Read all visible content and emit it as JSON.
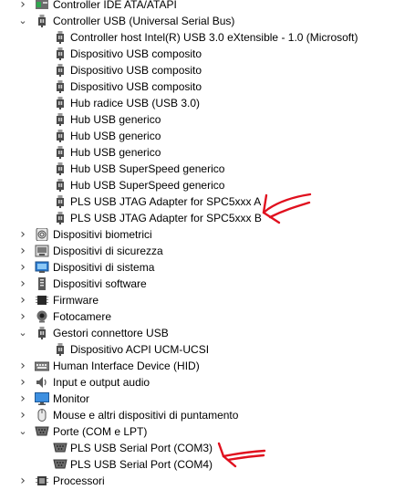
{
  "tree": [
    {
      "label": "Controller IDE ATA/ATAPI",
      "level": 0,
      "expand": "collapsed",
      "icon": "ide-controller-icon"
    },
    {
      "label": "Controller USB (Universal Serial Bus)",
      "level": 0,
      "expand": "expanded",
      "icon": "usb-plug-icon"
    },
    {
      "label": "Controller host Intel(R) USB 3.0 eXtensible - 1.0 (Microsoft)",
      "level": 1,
      "icon": "usb-plug-icon"
    },
    {
      "label": "Dispositivo USB composito",
      "level": 1,
      "icon": "usb-plug-icon"
    },
    {
      "label": "Dispositivo USB composito",
      "level": 1,
      "icon": "usb-plug-icon"
    },
    {
      "label": "Dispositivo USB composito",
      "level": 1,
      "icon": "usb-plug-icon"
    },
    {
      "label": "Hub radice USB (USB 3.0)",
      "level": 1,
      "icon": "usb-plug-icon"
    },
    {
      "label": "Hub USB generico",
      "level": 1,
      "icon": "usb-plug-icon"
    },
    {
      "label": "Hub USB generico",
      "level": 1,
      "icon": "usb-plug-icon"
    },
    {
      "label": "Hub USB generico",
      "level": 1,
      "icon": "usb-plug-icon"
    },
    {
      "label": "Hub USB SuperSpeed generico",
      "level": 1,
      "icon": "usb-plug-icon"
    },
    {
      "label": "Hub USB SuperSpeed generico",
      "level": 1,
      "icon": "usb-plug-icon"
    },
    {
      "label": "PLS USB JTAG Adapter for SPC5xxx A",
      "level": 1,
      "icon": "usb-plug-icon"
    },
    {
      "label": "PLS USB JTAG Adapter for SPC5xxx B",
      "level": 1,
      "icon": "usb-plug-icon"
    },
    {
      "label": "Dispositivi biometrici",
      "level": 0,
      "expand": "collapsed",
      "icon": "fingerprint-icon"
    },
    {
      "label": "Dispositivi di sicurezza",
      "level": 0,
      "expand": "collapsed",
      "icon": "security-device-icon"
    },
    {
      "label": "Dispositivi di sistema",
      "level": 0,
      "expand": "collapsed",
      "icon": "system-device-icon"
    },
    {
      "label": "Dispositivi software",
      "level": 0,
      "expand": "collapsed",
      "icon": "software-device-icon"
    },
    {
      "label": "Firmware",
      "level": 0,
      "expand": "collapsed",
      "icon": "firmware-chip-icon"
    },
    {
      "label": "Fotocamere",
      "level": 0,
      "expand": "collapsed",
      "icon": "webcam-icon"
    },
    {
      "label": "Gestori connettore USB",
      "level": 0,
      "expand": "expanded",
      "icon": "usb-plug-icon"
    },
    {
      "label": "Dispositivo ACPI UCM-UCSI",
      "level": 1,
      "icon": "usb-plug-icon"
    },
    {
      "label": "Human Interface Device (HID)",
      "level": 0,
      "expand": "collapsed",
      "icon": "keyboard-icon"
    },
    {
      "label": "Input e output audio",
      "level": 0,
      "expand": "collapsed",
      "icon": "speaker-icon"
    },
    {
      "label": "Monitor",
      "level": 0,
      "expand": "collapsed",
      "icon": "monitor-icon"
    },
    {
      "label": "Mouse e altri dispositivi di puntamento",
      "level": 0,
      "expand": "collapsed",
      "icon": "mouse-icon"
    },
    {
      "label": "Porte (COM e LPT)",
      "level": 0,
      "expand": "expanded",
      "icon": "port-icon"
    },
    {
      "label": "PLS USB Serial Port (COM3)",
      "level": 1,
      "icon": "port-icon"
    },
    {
      "label": "PLS USB Serial Port (COM4)",
      "level": 1,
      "icon": "port-icon"
    },
    {
      "label": "Processori",
      "level": 0,
      "expand": "collapsed",
      "icon": "processor-chip-icon"
    }
  ],
  "annotation_color": "#e0101e"
}
